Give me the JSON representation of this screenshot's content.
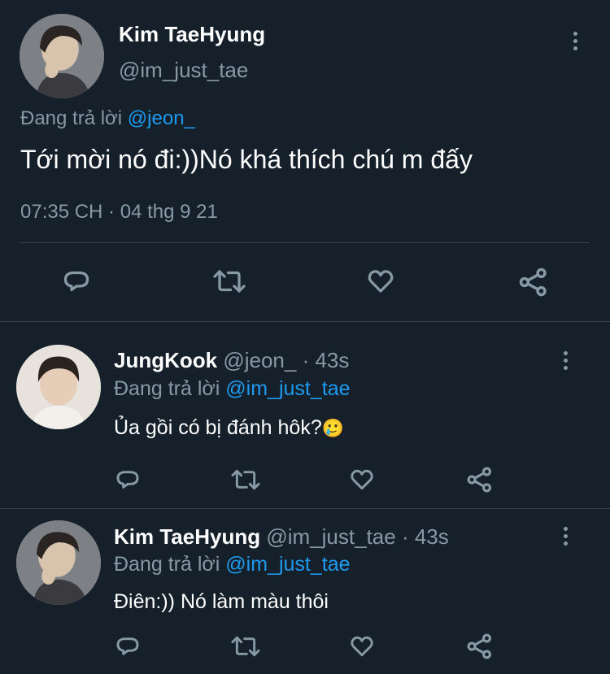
{
  "main_tweet": {
    "name": "Kim TaeHyung",
    "handle": "@im_just_tae",
    "reply_prefix": "Đang trả lời",
    "reply_to": "@jeon_",
    "text": "Tới mời nó đi:))Nó khá thích chú m đấy",
    "timestamp": "07:35 CH · 04 thg 9 21"
  },
  "replies": [
    {
      "name": "JungKook",
      "handle": "@jeon_",
      "time": "· 43s",
      "reply_prefix": "Đang trả lời",
      "reply_to": "@im_just_tae",
      "text": "Ủa gồi có bị đánh hôk?",
      "emoji": "🥲"
    },
    {
      "name": "Kim TaeHyung",
      "handle": "@im_just_tae",
      "time": "· 43s",
      "reply_prefix": "Đang trả lời",
      "reply_to": "@im_just_tae",
      "text": "Điên:)) Nó làm màu thôi",
      "emoji": ""
    }
  ],
  "icons": [
    "reply-icon",
    "retweet-icon",
    "like-icon",
    "share-icon",
    "more-icon"
  ],
  "colors": {
    "background": "#15202b",
    "text": "#ffffff",
    "muted": "#8899a6",
    "link": "#1d9bf0",
    "divider": "#38444d"
  }
}
